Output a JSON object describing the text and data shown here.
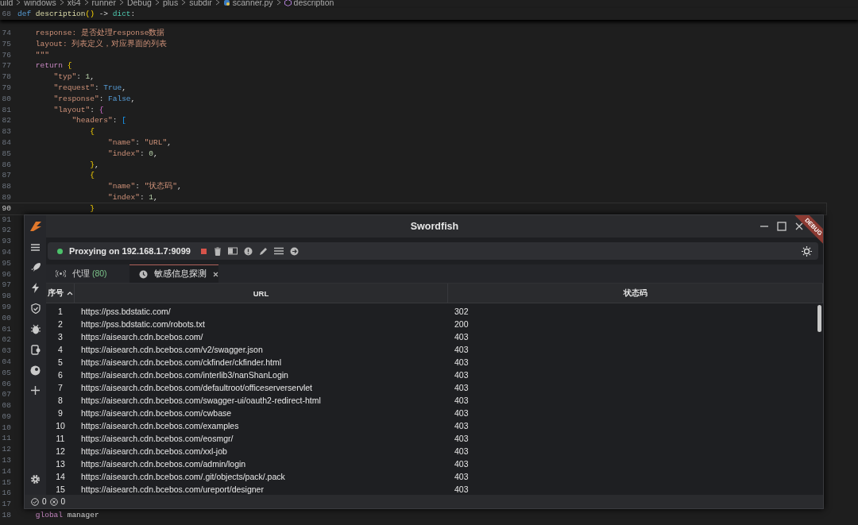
{
  "breadcrumb": [
    "uild",
    "windows",
    "x64",
    "runner",
    "Debug",
    "plus",
    "subdir",
    "scanner.py",
    "description"
  ],
  "editor": {
    "sticky_line": {
      "number": "68",
      "tokens": [
        {
          "kind": "keyword",
          "text": "def "
        },
        {
          "kind": "function",
          "text": "description"
        },
        {
          "kind": "brace1",
          "text": "()"
        },
        {
          "kind": "plain",
          "text": " -> "
        },
        {
          "kind": "type",
          "text": "dict"
        },
        {
          "kind": "plain",
          "text": ":"
        }
      ]
    },
    "lines": [
      {
        "number": "74",
        "current": false,
        "tokens": [
          {
            "kind": "string",
            "text": "    response: 是否处理response数据"
          }
        ]
      },
      {
        "number": "75",
        "current": false,
        "tokens": [
          {
            "kind": "string",
            "text": "    layout: 列表定义，对应界面的列表"
          }
        ]
      },
      {
        "number": "76",
        "current": false,
        "tokens": [
          {
            "kind": "string",
            "text": "    \"\"\""
          }
        ]
      },
      {
        "number": "77",
        "current": false,
        "tokens": [
          {
            "kind": "control",
            "text": "    return "
          },
          {
            "kind": "brace1",
            "text": "{"
          }
        ]
      },
      {
        "number": "78",
        "current": false,
        "tokens": [
          {
            "kind": "string",
            "text": "        \"typ\""
          },
          {
            "kind": "plain",
            "text": ": "
          },
          {
            "kind": "number",
            "text": "1"
          },
          {
            "kind": "plain",
            "text": ","
          }
        ]
      },
      {
        "number": "79",
        "current": false,
        "tokens": [
          {
            "kind": "string",
            "text": "        \"request\""
          },
          {
            "kind": "plain",
            "text": ": "
          },
          {
            "kind": "constant",
            "text": "True"
          },
          {
            "kind": "plain",
            "text": ","
          }
        ]
      },
      {
        "number": "80",
        "current": false,
        "tokens": [
          {
            "kind": "string",
            "text": "        \"response\""
          },
          {
            "kind": "plain",
            "text": ": "
          },
          {
            "kind": "constant",
            "text": "False"
          },
          {
            "kind": "plain",
            "text": ","
          }
        ]
      },
      {
        "number": "81",
        "current": false,
        "tokens": [
          {
            "kind": "string",
            "text": "        \"layout\""
          },
          {
            "kind": "plain",
            "text": ": "
          },
          {
            "kind": "brace2",
            "text": "{"
          }
        ]
      },
      {
        "number": "82",
        "current": false,
        "tokens": [
          {
            "kind": "string",
            "text": "            \"headers\""
          },
          {
            "kind": "plain",
            "text": ": "
          },
          {
            "kind": "brace3",
            "text": "["
          }
        ]
      },
      {
        "number": "83",
        "current": false,
        "tokens": [
          {
            "kind": "brace1",
            "text": "                {"
          }
        ]
      },
      {
        "number": "84",
        "current": false,
        "tokens": [
          {
            "kind": "string",
            "text": "                    \"name\""
          },
          {
            "kind": "plain",
            "text": ": "
          },
          {
            "kind": "string",
            "text": "\"URL\""
          },
          {
            "kind": "plain",
            "text": ","
          }
        ]
      },
      {
        "number": "85",
        "current": false,
        "tokens": [
          {
            "kind": "string",
            "text": "                    \"index\""
          },
          {
            "kind": "plain",
            "text": ": "
          },
          {
            "kind": "number",
            "text": "0"
          },
          {
            "kind": "plain",
            "text": ","
          }
        ]
      },
      {
        "number": "86",
        "current": false,
        "tokens": [
          {
            "kind": "brace1",
            "text": "                }"
          },
          {
            "kind": "plain",
            "text": ","
          }
        ]
      },
      {
        "number": "87",
        "current": false,
        "tokens": [
          {
            "kind": "brace1",
            "text": "                {"
          }
        ]
      },
      {
        "number": "88",
        "current": false,
        "tokens": [
          {
            "kind": "string",
            "text": "                    \"name\""
          },
          {
            "kind": "plain",
            "text": ": "
          },
          {
            "kind": "string",
            "text": "\"状态码\""
          },
          {
            "kind": "plain",
            "text": ","
          }
        ]
      },
      {
        "number": "89",
        "current": false,
        "tokens": [
          {
            "kind": "string",
            "text": "                    \"index\""
          },
          {
            "kind": "plain",
            "text": ": "
          },
          {
            "kind": "number",
            "text": "1"
          },
          {
            "kind": "plain",
            "text": ","
          }
        ]
      },
      {
        "number": "90",
        "current": true,
        "tokens": [
          {
            "kind": "brace1",
            "text": "                }"
          }
        ]
      },
      {
        "number": "91",
        "current": false
      },
      {
        "number": "92",
        "current": false
      },
      {
        "number": "93",
        "current": false
      },
      {
        "number": "94",
        "current": false
      },
      {
        "number": "95",
        "current": false
      },
      {
        "number": "96",
        "current": false
      },
      {
        "number": "97",
        "current": false
      },
      {
        "number": "98",
        "current": false
      },
      {
        "number": "99",
        "current": false
      },
      {
        "number": "00",
        "current": false
      },
      {
        "number": "01",
        "current": false
      },
      {
        "number": "02",
        "current": false
      },
      {
        "number": "03",
        "current": false
      },
      {
        "number": "04",
        "current": false
      },
      {
        "number": "05",
        "current": false
      },
      {
        "number": "06",
        "current": false
      },
      {
        "number": "07",
        "current": false
      },
      {
        "number": "08",
        "current": false
      },
      {
        "number": "09",
        "current": false
      },
      {
        "number": "10",
        "current": false
      },
      {
        "number": "11",
        "current": false
      },
      {
        "number": "12",
        "current": false
      },
      {
        "number": "13",
        "current": false
      },
      {
        "number": "14",
        "current": false
      },
      {
        "number": "15",
        "current": false
      },
      {
        "number": "16",
        "current": false
      },
      {
        "number": "17",
        "current": false
      },
      {
        "number": "18",
        "current": false,
        "tokens": [
          {
            "kind": "control",
            "text": "    global"
          },
          {
            "kind": "plain",
            "text": " manager"
          }
        ]
      }
    ]
  },
  "app": {
    "title": "Swordfish",
    "ribbon": "DEBUG",
    "toolbar": {
      "status": "Proxying on 192.168.1.7:9099",
      "running": true
    },
    "tabs": [
      {
        "label": "代理",
        "count": "(80)",
        "selected": false,
        "closable": false
      },
      {
        "label": "敏感信息探测",
        "selected": true,
        "closable": true
      }
    ],
    "table": {
      "columns": [
        {
          "label": "序号",
          "sorted": true
        },
        {
          "label": "URL",
          "sorted": false
        },
        {
          "label": "状态码",
          "sorted": false
        }
      ],
      "rows": [
        [
          "1",
          "https://pss.bdstatic.com/",
          "302"
        ],
        [
          "2",
          "https://pss.bdstatic.com/robots.txt",
          "200"
        ],
        [
          "3",
          "https://aisearch.cdn.bcebos.com/",
          "403"
        ],
        [
          "4",
          "https://aisearch.cdn.bcebos.com/v2/swagger.json",
          "403"
        ],
        [
          "5",
          "https://aisearch.cdn.bcebos.com/ckfinder/ckfinder.html",
          "403"
        ],
        [
          "6",
          "https://aisearch.cdn.bcebos.com/interlib3/nanShanLogin",
          "403"
        ],
        [
          "7",
          "https://aisearch.cdn.bcebos.com/defaultroot/officeserverservlet",
          "403"
        ],
        [
          "8",
          "https://aisearch.cdn.bcebos.com/swagger-ui/oauth2-redirect-html",
          "403"
        ],
        [
          "9",
          "https://aisearch.cdn.bcebos.com/cwbase",
          "403"
        ],
        [
          "10",
          "https://aisearch.cdn.bcebos.com/examples",
          "403"
        ],
        [
          "11",
          "https://aisearch.cdn.bcebos.com/eosmgr/",
          "403"
        ],
        [
          "12",
          "https://aisearch.cdn.bcebos.com/xxl-job",
          "403"
        ],
        [
          "13",
          "https://aisearch.cdn.bcebos.com/admin/login",
          "403"
        ],
        [
          "14",
          "https://aisearch.cdn.bcebos.com/.git/objects/pack/.pack",
          "403"
        ],
        [
          "15",
          "https://aisearch.cdn.bcebos.com/ureport/designer",
          "403"
        ]
      ]
    },
    "status_bar": {
      "ok_count": "0",
      "error_count": "0"
    }
  }
}
